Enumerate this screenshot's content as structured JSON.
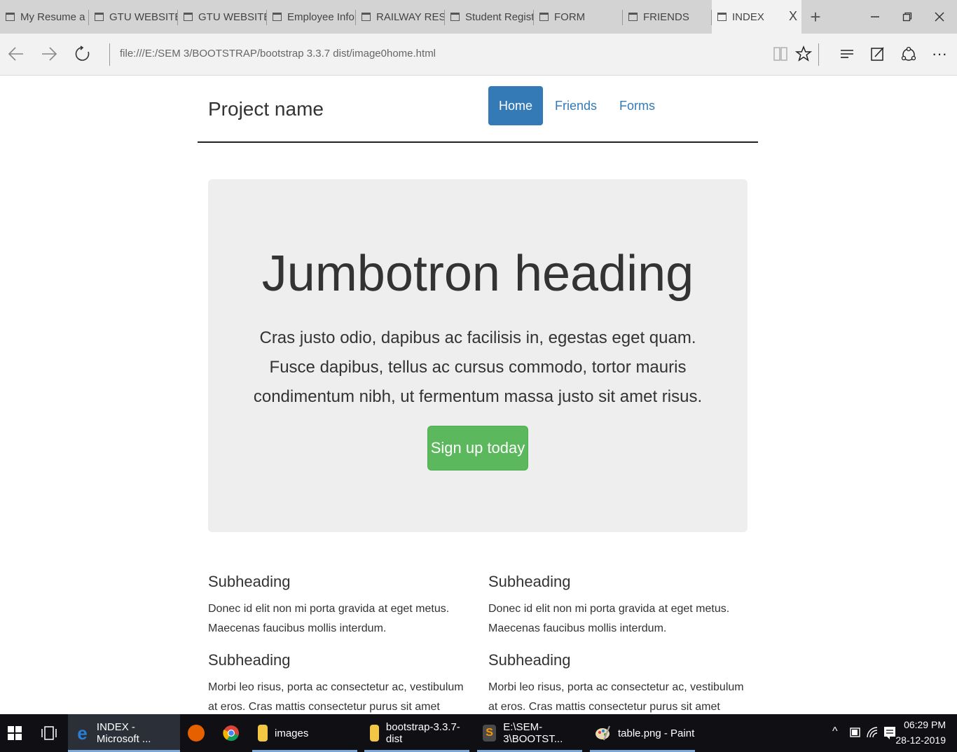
{
  "browser": {
    "tabs": [
      {
        "label": "My Resume a P"
      },
      {
        "label": "GTU WEBSITE"
      },
      {
        "label": "GTU WEBSITE"
      },
      {
        "label": "Employee Infor"
      },
      {
        "label": "RAILWAY RESIS"
      },
      {
        "label": "Student Registr"
      },
      {
        "label": "FORM"
      },
      {
        "label": "FRIENDS"
      },
      {
        "label": "INDEX"
      }
    ],
    "close_tab_glyph": "X",
    "new_tab_glyph": "+",
    "url": "file:///E:/SEM  3/BOOTSTRAP/bootstrap  3.3.7  dist/image0home.html",
    "more_glyph": "···"
  },
  "page": {
    "brand": "Project name",
    "nav": [
      {
        "label": "Home"
      },
      {
        "label": "Friends"
      },
      {
        "label": "Forms"
      }
    ],
    "jumbotron": {
      "heading": "Jumbotron heading",
      "lead": "Cras justo odio, dapibus ac facilisis in, egestas eget quam. Fusce dapibus, tellus ac cursus commodo, tortor mauris condimentum nibh, ut fermentum massa justo sit amet risus.",
      "button": "Sign up today"
    },
    "marketing": [
      {
        "heading": "Subheading",
        "text": "Donec id elit non mi porta gravida at eget metus. Maecenas faucibus mollis interdum."
      },
      {
        "heading": "Subheading",
        "text": "Donec id elit non mi porta gravida at eget metus. Maecenas faucibus mollis interdum."
      },
      {
        "heading": "Subheading",
        "text": "Morbi leo risus, porta ac consectetur ac, vestibulum at eros. Cras mattis consectetur purus sit amet fermentum."
      },
      {
        "heading": "Subheading",
        "text": "Morbi leo risus, porta ac consectetur ac, vestibulum at eros. Cras mattis consectetur purus sit amet fermentum."
      }
    ]
  },
  "taskbar": {
    "items": [
      {
        "label": "INDEX - Microsoft ..."
      },
      {
        "label": "images"
      },
      {
        "label": "bootstrap-3.3.7-dist"
      },
      {
        "label": "E:\\SEM-3\\BOOTST..."
      },
      {
        "label": "table.png - Paint"
      }
    ],
    "time": "06:29 PM",
    "date": "28-12-2019"
  },
  "colors": {
    "primary": "#337ab7",
    "success": "#5cb85c",
    "jumbotron_bg": "#eeeeee"
  }
}
